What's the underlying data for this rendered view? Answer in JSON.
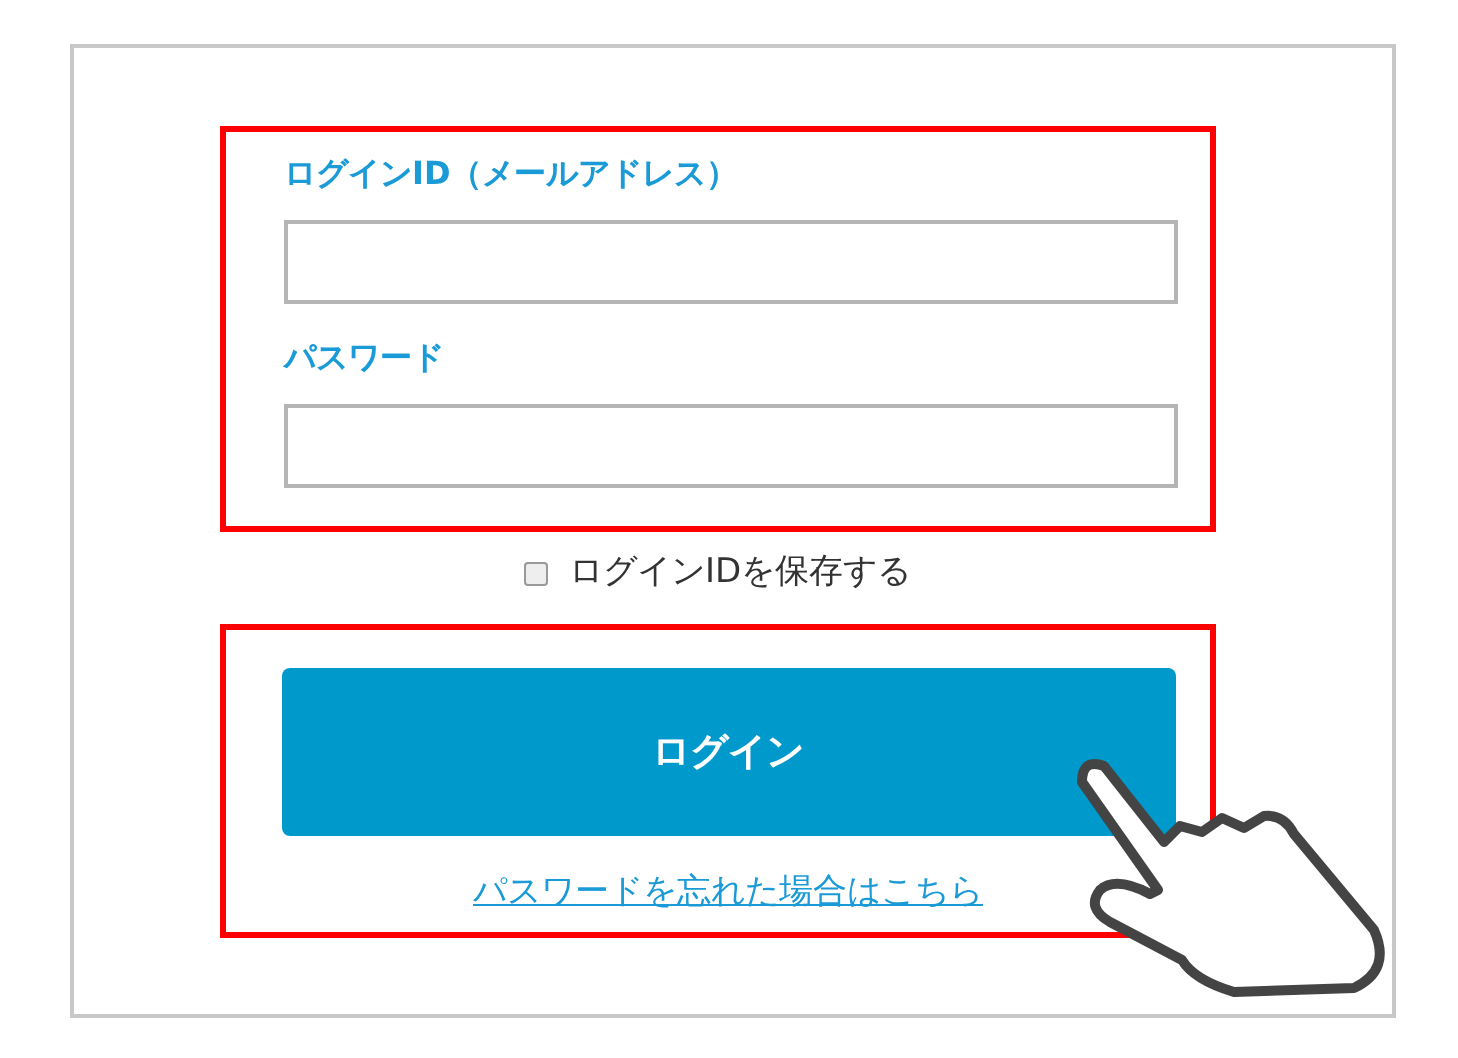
{
  "login_form": {
    "id_label": "ログインID（メールアドレス）",
    "password_label": "パスワード",
    "remember": {
      "label": "ログインIDを保存する",
      "checked": false
    },
    "login_button": "ログイン",
    "forgot_link": "パスワードを忘れた場合はこちら"
  }
}
